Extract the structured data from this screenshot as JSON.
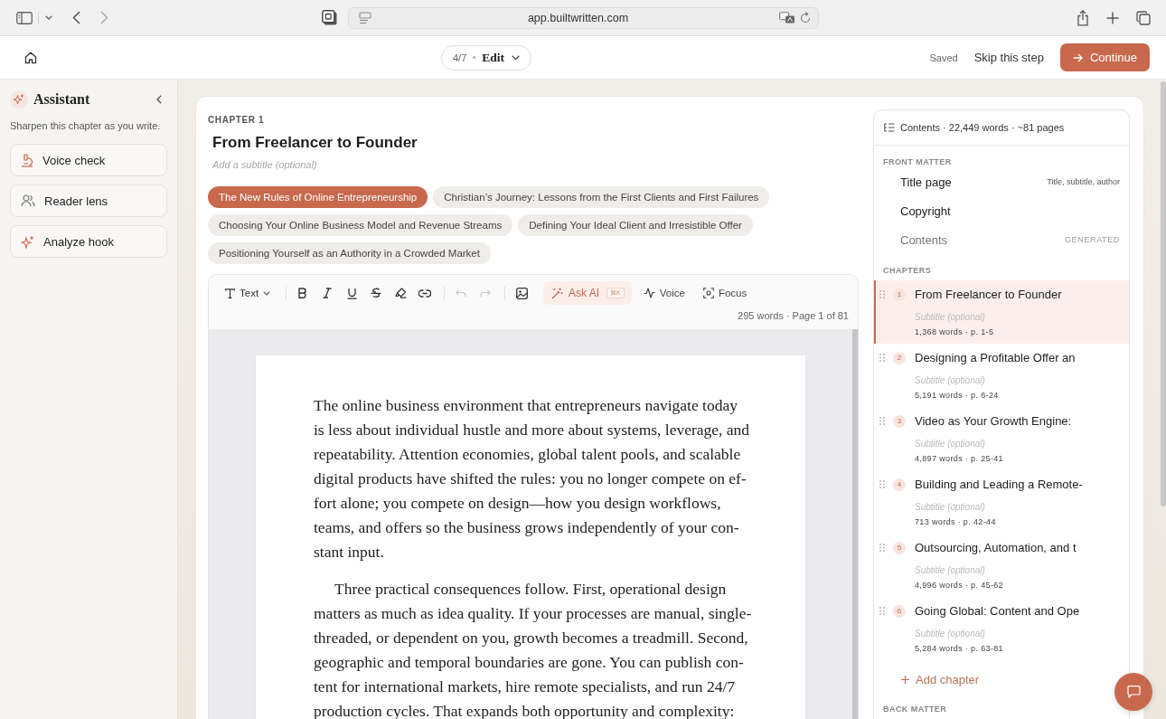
{
  "browser": {
    "url": "app.builtwritten.com"
  },
  "header": {
    "step": "4/7",
    "mode": "Edit",
    "status": "Saved",
    "skip": "Skip this step",
    "continue": "Continue"
  },
  "assistant": {
    "title": "Assistant",
    "description": "Sharpen this chapter as you write.",
    "tools": [
      {
        "kind": "voice",
        "label": "Voice check"
      },
      {
        "kind": "reader",
        "label": "Reader lens"
      },
      {
        "kind": "hook",
        "label": "Analyze hook"
      }
    ]
  },
  "chapter": {
    "label": "CHAPTER 1",
    "title": "From Freelancer to Founder",
    "subtitle_placeholder": "Add a subtitle (optional)",
    "sections": [
      {
        "label": "The New Rules of Online Entrepreneurship",
        "selected": true
      },
      {
        "label": "Christian’s Journey: Lessons from the First Clients and First Failures",
        "selected": false
      },
      {
        "label": "Choosing Your Online Business Model and Revenue Streams",
        "selected": false
      },
      {
        "label": "Defining Your Ideal Client and Irresistible Offer",
        "selected": false
      },
      {
        "label": "Positioning Yourself as an Authority in a Crowded Market",
        "selected": false
      }
    ]
  },
  "editor": {
    "style_menu": "Text",
    "button_groups": [
      [
        {
          "kind": "bold",
          "disabled": false
        },
        {
          "kind": "italic",
          "disabled": false
        },
        {
          "kind": "underline",
          "disabled": false
        },
        {
          "kind": "strikethrough",
          "disabled": false
        },
        {
          "kind": "highlight",
          "disabled": false
        },
        {
          "kind": "link",
          "disabled": false
        }
      ],
      [
        {
          "kind": "undo",
          "disabled": true
        },
        {
          "kind": "redo",
          "disabled": true
        }
      ],
      [
        {
          "kind": "image",
          "disabled": false
        }
      ]
    ],
    "ask_ai": {
      "label": "Ask AI",
      "shortcut": "⌘K"
    },
    "voice": "Voice",
    "focus": "Focus",
    "stats": "295 words · Page 1 of 81",
    "paragraphs": [
      {
        "lines": [
          "The online business environment that entrepreneurs navigate today",
          "is less about individual hustle and more about systems, leverage, and",
          "repeatability. Attention economies, global talent pools, and scalable",
          "digital products have shifted the rules: you no longer compete on ef-",
          "fort alone; you compete on design—how you design workflows,",
          "teams, and offers so the business grows independently of your con-",
          "stant input."
        ]
      },
      {
        "lines": [
          "Three practical consequences follow. First, operational design",
          "matters as much as idea quality. If your processes are manual, single-",
          "threaded, or dependent on you, growth becomes a treadmill. Second,",
          "geographic and temporal boundaries are gone. You can publish con-",
          "tent for international markets, hire remote specialists, and run 24/7",
          "production cycles. That expands both opportunity and complexity:"
        ]
      }
    ]
  },
  "contents": {
    "summary": "Contents · 22,449 words · ~81 pages",
    "front_matter": {
      "heading": "FRONT MATTER",
      "items": [
        {
          "kind": "page",
          "label": "Title page",
          "note": "Title, subtitle, author"
        },
        {
          "kind": "page",
          "label": "Copyright"
        },
        {
          "kind": "generated",
          "label": "Contents",
          "note": "GENERATED"
        }
      ]
    },
    "chapters": {
      "heading": "CHAPTERS",
      "items": [
        {
          "number": "1",
          "title": "From Freelancer to Founder",
          "subtitle_placeholder": "Subtitle (optional)",
          "meta": "1,368 words · p. 1-5",
          "selected": true
        },
        {
          "number": "2",
          "title": "Designing a Profitable Offer an",
          "subtitle_placeholder": "Subtitle (optional)",
          "meta": "5,191 words · p. 6-24",
          "selected": false
        },
        {
          "number": "3",
          "title": "Video as Your Growth Engine:",
          "subtitle_placeholder": "Subtitle (optional)",
          "meta": "4,897 words · p. 25-41",
          "selected": false
        },
        {
          "number": "4",
          "title": "Building and Leading a Remote-",
          "subtitle_placeholder": "Subtitle (optional)",
          "meta": "713 words · p. 42-44",
          "selected": false
        },
        {
          "number": "5",
          "title": "Outsourcing, Automation, and t",
          "subtitle_placeholder": "Subtitle (optional)",
          "meta": "4,996 words · p. 45-62",
          "selected": false
        },
        {
          "number": "6",
          "title": "Going Global: Content and Ope",
          "subtitle_placeholder": "Subtitle (optional)",
          "meta": "5,284 words · p. 63-81",
          "selected": false
        }
      ],
      "add": "Add chapter"
    },
    "back_matter": {
      "heading": "BACK MATTER"
    }
  }
}
